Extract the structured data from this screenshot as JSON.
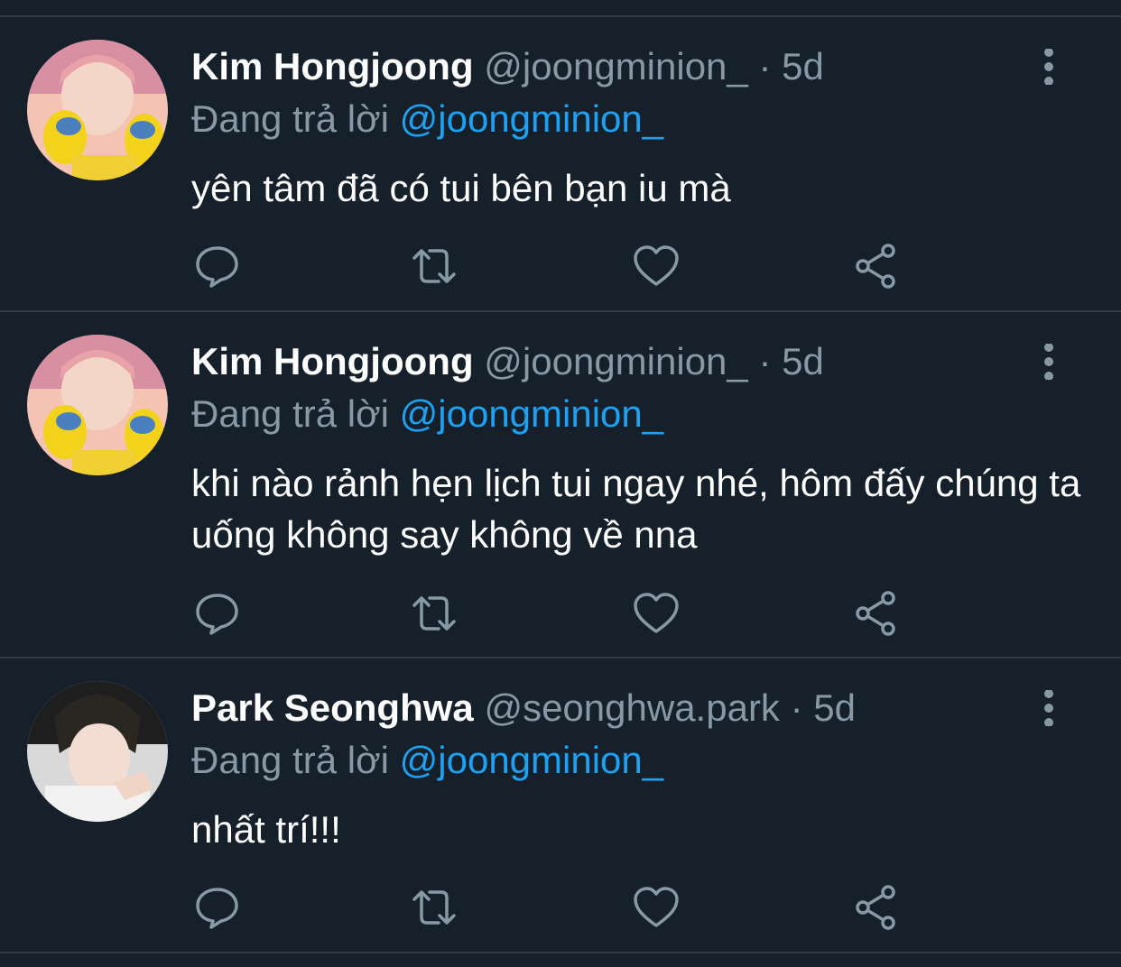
{
  "colors": {
    "background": "#15202b",
    "divider": "#2f3a46",
    "muted": "#8899a6",
    "mention": "#1da1f2",
    "text": "#ffffff"
  },
  "tweets": [
    {
      "name": "Kim Hongjoong",
      "handle": "@joongminion_",
      "separator": "·",
      "time": "5d",
      "reply_prefix": "Đang trả lời",
      "reply_to": "@joongminion_",
      "text": "yên tâm đã có tui bên bạn iu mà",
      "avatar_icon": "avatar-photo"
    },
    {
      "name": "Kim Hongjoong",
      "handle": "@joongminion_",
      "separator": "·",
      "time": "5d",
      "reply_prefix": "Đang trả lời",
      "reply_to": "@joongminion_",
      "text": "khi nào rảnh hẹn lịch tui ngay nhé, hôm đấy chúng ta uống không say không về nna",
      "avatar_icon": "avatar-photo"
    },
    {
      "name": "Park Seonghwa",
      "handle": "@seonghwa.park",
      "separator": "·",
      "time": "5d",
      "reply_prefix": "Đang trả lời",
      "reply_to": "@joongminion_",
      "text": "nhất trí!!!",
      "avatar_icon": "avatar-photo"
    }
  ],
  "action_icons": [
    "reply-icon",
    "retweet-icon",
    "like-icon",
    "share-icon"
  ]
}
